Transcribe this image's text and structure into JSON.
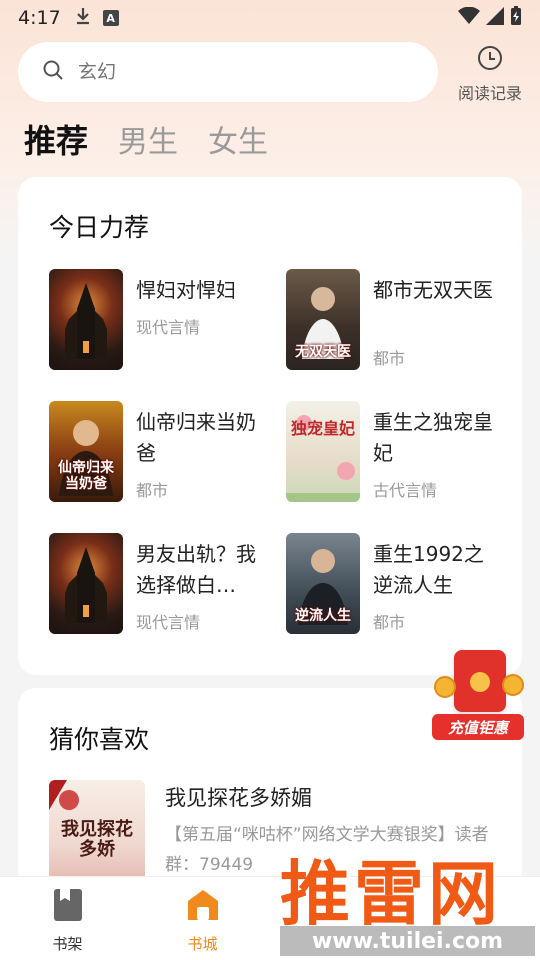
{
  "status_bar": {
    "time": "4:17",
    "icons": [
      "download-icon",
      "font-icon",
      "wifi-icon",
      "signal-icon",
      "battery-charging-icon"
    ]
  },
  "search": {
    "placeholder": "玄幻"
  },
  "history": {
    "label": "阅读记录"
  },
  "tabs": [
    {
      "label": "推荐",
      "active": true
    },
    {
      "label": "男生",
      "active": false
    },
    {
      "label": "女生",
      "active": false
    }
  ],
  "recommend": {
    "title": "今日力荐",
    "books": [
      {
        "name": "悍妇对悍妇",
        "genre": "现代言情",
        "cover_text": ""
      },
      {
        "name": "都市无双天医",
        "genre": "都市",
        "cover_text": "无双天医"
      },
      {
        "name": "仙帝归来当奶爸",
        "genre": "都市",
        "cover_text": "仙帝归来当奶爸"
      },
      {
        "name": "重生之独宠皇妃",
        "genre": "古代言情",
        "cover_text": "独宠皇妃"
      },
      {
        "name": "男友出轨？我选择做白…",
        "genre": "现代言情",
        "cover_text": ""
      },
      {
        "name": "重生1992之逆流人生",
        "genre": "都市",
        "cover_text": "逆流人生"
      }
    ]
  },
  "guess": {
    "title": "猜你喜欢",
    "book": {
      "name": "我见探花多娇媚",
      "desc": "【第五届“咪咕杯”网络文学大赛银奖】读者群：79449",
      "cover_text": "我见探花多娇"
    }
  },
  "promo": {
    "label": "充值钜惠"
  },
  "bottom_nav": [
    {
      "label": "书架",
      "icon": "bookshelf-icon",
      "active": false
    },
    {
      "label": "书城",
      "icon": "store-icon",
      "active": true
    }
  ],
  "watermark": {
    "title": "推雷网",
    "url": "www.tuilei.com"
  },
  "colors": {
    "accent": "#f08a1c",
    "promo_red": "#e6302b",
    "watermark_orange": "#f05a14"
  }
}
